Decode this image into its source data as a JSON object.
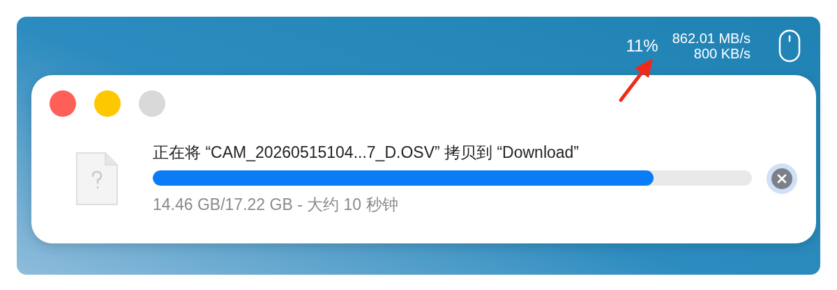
{
  "status": {
    "cpu": "11%",
    "speed_up": "862.01 MB/s",
    "speed_down": "800 KB/s"
  },
  "window_buttons": [
    {
      "color": "#fe5f57"
    },
    {
      "color": "#fdc800"
    },
    {
      "color": "#d9d9d9"
    }
  ],
  "copy": {
    "title": "正在将 “CAM_20260515104...7_D.OSV” 拷贝到 “Download”",
    "level": 0.836,
    "detail": "14.46 GB/17.22 GB - 大约 10 秒钟"
  }
}
